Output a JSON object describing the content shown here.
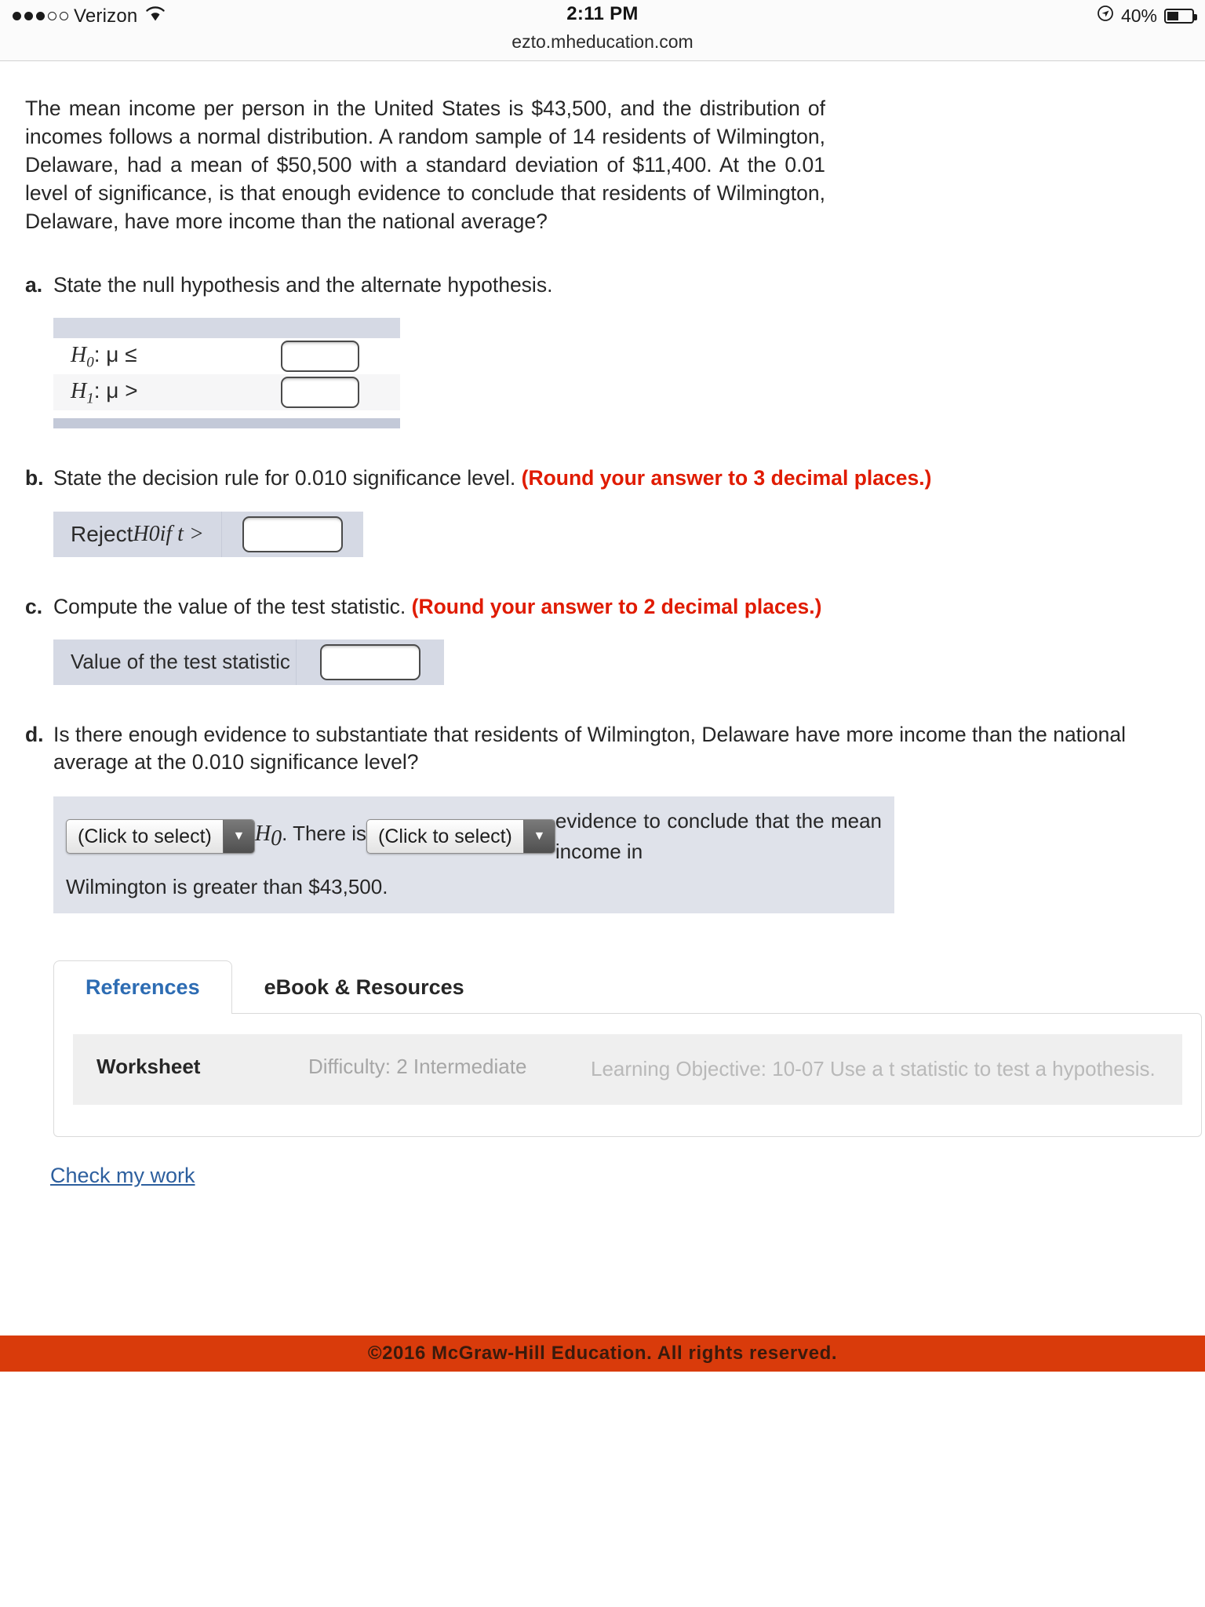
{
  "statusbar": {
    "carrier": "Verizon",
    "signal_dots_filled": 3,
    "signal_dots_hollow": 2,
    "wifi_icon": "wifi-icon",
    "time": "2:11 PM",
    "url": "ezto.mheducation.com",
    "location_icon": "location-arrow-icon",
    "battery_percent": "40%",
    "battery_icon": "battery-icon"
  },
  "question": {
    "prompt": "The mean income per person in the United States is $43,500, and the distribution of incomes follows a normal distribution. A random sample of 14 residents of Wilmington, Delaware, had a mean of $50,500 with a standard deviation of $11,400. At the 0.01 level of significance, is that enough evidence to conclude that residents of Wilmington, Delaware, have more income than the national average?"
  },
  "parts": {
    "a": {
      "letter": "a.",
      "text": "State the null hypothesis and the alternate hypothesis.",
      "rows": [
        {
          "label_h": "H",
          "label_sub": "0",
          "label_rest": ": μ ≤",
          "value": ""
        },
        {
          "label_h": "H",
          "label_sub": "1",
          "label_rest": ": μ >",
          "value": ""
        }
      ]
    },
    "b": {
      "letter": "b.",
      "text": "State the decision rule for 0.010 significance level.",
      "note": "(Round your answer to 3 decimal places.)",
      "row_label_pre": "Reject ",
      "row_label_h": "H",
      "row_label_sub": "0",
      "row_label_post": " if t >",
      "value": ""
    },
    "c": {
      "letter": "c.",
      "text": "Compute the value of the test statistic.",
      "note": "(Round your answer to 2 decimal places.)",
      "row_label": "Value of the test statistic",
      "value": ""
    },
    "d": {
      "letter": "d.",
      "text": "Is there enough evidence to substantiate that residents of Wilmington, Delaware have more income than the national average at the 0.010 significance level?",
      "select1": "(Click to select)",
      "mid_h": "H",
      "mid_sub": "0",
      "mid_text": ". There is",
      "select2": "(Click to select)",
      "tail_text": "evidence to conclude that the mean income in",
      "line2": "Wilmington is greater than $43,500."
    }
  },
  "tabs": [
    {
      "label": "References",
      "active": true
    },
    {
      "label": "eBook & Resources",
      "active": false
    }
  ],
  "meta": {
    "title": "Worksheet",
    "difficulty": "Difficulty: 2 Intermediate",
    "learning_objective": "Learning Objective: 10-07 Use a t statistic to test a hypothesis."
  },
  "check_work_link": "Check my work",
  "footer": {
    "copyright": "©2016 McGraw-Hill Education. All rights reserved.",
    "bar_color": "#d93b0b"
  },
  "colors": {
    "accent_blue": "#2d6cb3",
    "warning_red": "#e01b00",
    "table_header": "#d5d9e4",
    "panel_bg": "#dfe2ea"
  }
}
